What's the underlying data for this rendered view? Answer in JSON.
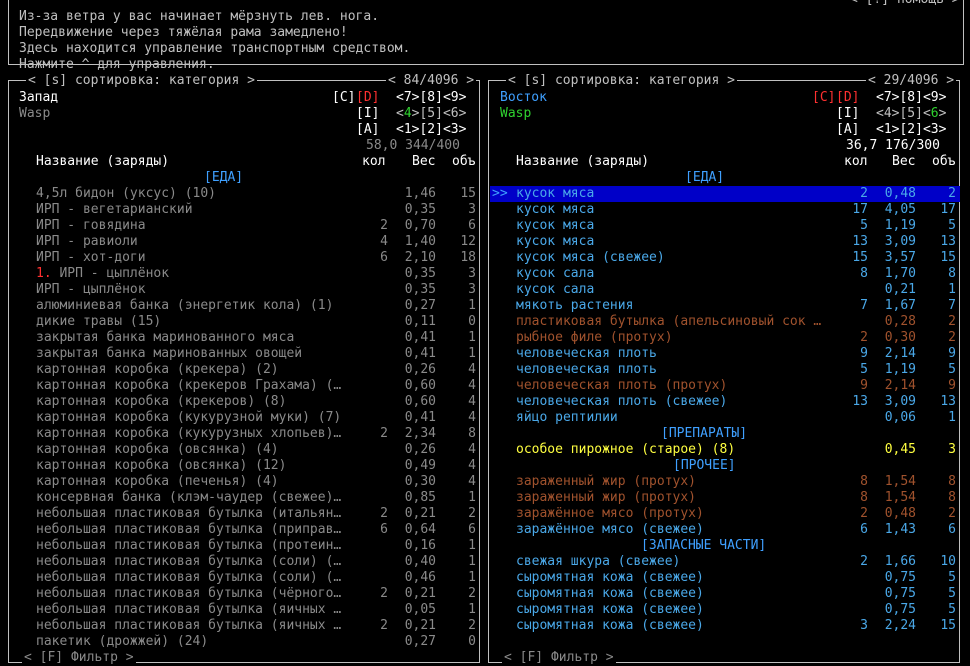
{
  "top": {
    "help": "< [?] помощь >",
    "messages": [
      "Из-за ветра у вас начинает мёрзнуть лев. нога.",
      "Передвижение через тяжёлая рама замедлено!",
      "Здесь находится управление транспортным средством.",
      "Нажмите ^ для управления."
    ]
  },
  "left": {
    "sort": "< [s] сортировка: категория >",
    "count": "< 84/4096 >",
    "location": "Запад",
    "vehicle": "Wasp",
    "tags": [
      "[C]",
      "[D]",
      "[I]",
      "[A]"
    ],
    "grid1": "<7>[8]<9>",
    "grid2": "<4>[5]<6>",
    "grid2_hl": "4",
    "grid3": "<1>[2]<3>",
    "weight_volume": "58,0 344/400",
    "header": {
      "name": "Название (заряды)",
      "qty": "кол",
      "weight": "Вес",
      "vol": "объ"
    },
    "category": "[ЕДА]",
    "items": [
      {
        "n": "4,5л бидон (уксус) (10)",
        "q": "",
        "w": "1,46",
        "v": "15"
      },
      {
        "n": "ИРП - вегетарианский",
        "q": "",
        "w": "0,35",
        "v": "3"
      },
      {
        "n": "ИРП - говядина",
        "q": "2",
        "w": "0,70",
        "v": "6"
      },
      {
        "n": "ИРП - равиоли",
        "q": "4",
        "w": "1,40",
        "v": "12"
      },
      {
        "n": "ИРП - хот-доги",
        "q": "6",
        "w": "2,10",
        "v": "18"
      },
      {
        "n": "ИРП - цыплёнок",
        "q": "",
        "w": "0,35",
        "v": "3",
        "mark": "1. "
      },
      {
        "n": "ИРП - цыплёнок",
        "q": "",
        "w": "0,35",
        "v": "3"
      },
      {
        "n": "алюминиевая банка (энергетик кола) (1)",
        "q": "",
        "w": "0,27",
        "v": "1"
      },
      {
        "n": "дикие травы (15)",
        "q": "",
        "w": "0,11",
        "v": "0"
      },
      {
        "n": "закрытая банка маринованного мяса",
        "q": "",
        "w": "0,41",
        "v": "1"
      },
      {
        "n": "закрытая банка маринованных овощей",
        "q": "",
        "w": "0,41",
        "v": "1"
      },
      {
        "n": "картонная коробка (крекера) (2)",
        "q": "",
        "w": "0,26",
        "v": "4"
      },
      {
        "n": "картонная коробка (крекеров Грахама) (…",
        "q": "",
        "w": "0,60",
        "v": "4"
      },
      {
        "n": "картонная коробка (крекеров) (8)",
        "q": "",
        "w": "0,60",
        "v": "4"
      },
      {
        "n": "картонная коробка (кукурузной муки) (7)",
        "q": "",
        "w": "0,41",
        "v": "4"
      },
      {
        "n": "картонная коробка (кукурузных хлопьев)…",
        "q": "2",
        "w": "2,34",
        "v": "8"
      },
      {
        "n": "картонная коробка (овсянка) (4)",
        "q": "",
        "w": "0,26",
        "v": "4"
      },
      {
        "n": "картонная коробка (овсянка) (12)",
        "q": "",
        "w": "0,49",
        "v": "4"
      },
      {
        "n": "картонная коробка (печенья) (4)",
        "q": "",
        "w": "0,30",
        "v": "4"
      },
      {
        "n": "консервная банка (клэм-чаудер (свежее)…",
        "q": "",
        "w": "0,85",
        "v": "1"
      },
      {
        "n": "небольшая пластиковая бутылка (итальян…",
        "q": "2",
        "w": "0,21",
        "v": "2"
      },
      {
        "n": "небольшая пластиковая бутылка (приправ…",
        "q": "6",
        "w": "0,64",
        "v": "6"
      },
      {
        "n": "небольшая пластиковая бутылка (протеин…",
        "q": "",
        "w": "0,16",
        "v": "1"
      },
      {
        "n": "небольшая пластиковая бутылка (соли) (…",
        "q": "",
        "w": "0,40",
        "v": "1"
      },
      {
        "n": "небольшая пластиковая бутылка (соли) (…",
        "q": "",
        "w": "0,46",
        "v": "1"
      },
      {
        "n": "небольшая пластиковая бутылка (чёрного…",
        "q": "2",
        "w": "0,21",
        "v": "2"
      },
      {
        "n": "небольшая пластиковая бутылка (яичных …",
        "q": "",
        "w": "0,05",
        "v": "1"
      },
      {
        "n": "небольшая пластиковая бутылка (яичных …",
        "q": "2",
        "w": "0,21",
        "v": "2"
      },
      {
        "n": "пакетик (дрожжей) (24)",
        "q": "",
        "w": "0,27",
        "v": "0"
      }
    ],
    "filter": "< [F] Фильтр >"
  },
  "right": {
    "sort": "< [s] сортировка: категория >",
    "count": "< 29/4096 >",
    "location": "Восток",
    "vehicle": "Wasp",
    "tags": [
      "[C]",
      "[D]",
      "[I]",
      "[A]"
    ],
    "grid1": "<7>[8]<9>",
    "grid2": "<4>[5]<6>",
    "grid2_hl": "6",
    "grid3": "<1>[2]<3>",
    "weight_volume": "36,7 176/300",
    "header": {
      "name": "Название (заряды)",
      "qty": "кол",
      "weight": "Вес",
      "vol": "объ"
    },
    "cursor": ">>",
    "sections": [
      {
        "category": "[ЕДА]",
        "items": [
          {
            "n": "кусок мяса",
            "q": "2",
            "w": "0,48",
            "v": "2",
            "c": "blue",
            "sel": true
          },
          {
            "n": "кусок мяса",
            "q": "17",
            "w": "4,05",
            "v": "17",
            "c": "blue"
          },
          {
            "n": "кусок мяса",
            "q": "5",
            "w": "1,19",
            "v": "5",
            "c": "blue"
          },
          {
            "n": "кусок мяса",
            "q": "13",
            "w": "3,09",
            "v": "13",
            "c": "blue"
          },
          {
            "n": "кусок мяса (свежее)",
            "q": "15",
            "w": "3,57",
            "v": "15",
            "c": "blue"
          },
          {
            "n": "кусок сала",
            "q": "8",
            "w": "1,70",
            "v": "8",
            "c": "blue"
          },
          {
            "n": "кусок сала",
            "q": "",
            "w": "0,21",
            "v": "1",
            "c": "blue"
          },
          {
            "n": "мякоть растения",
            "q": "7",
            "w": "1,67",
            "v": "7",
            "c": "blue"
          },
          {
            "n": "пластиковая бутылка (апельсиновый сок …",
            "q": "",
            "w": "0,28",
            "v": "2",
            "c": "brown"
          },
          {
            "n": "рыбное филе (протух)",
            "q": "2",
            "w": "0,30",
            "v": "2",
            "c": "brown"
          },
          {
            "n": "человеческая плоть",
            "q": "9",
            "w": "2,14",
            "v": "9",
            "c": "blue"
          },
          {
            "n": "человеческая плоть",
            "q": "5",
            "w": "1,19",
            "v": "5",
            "c": "blue"
          },
          {
            "n": "человеческая плоть (протух)",
            "q": "9",
            "w": "2,14",
            "v": "9",
            "c": "brown"
          },
          {
            "n": "человеческая плоть (свежее)",
            "q": "13",
            "w": "3,09",
            "v": "13",
            "c": "blue"
          },
          {
            "n": "яйцо рептилии",
            "q": "",
            "w": "0,06",
            "v": "1",
            "c": "blue"
          }
        ]
      },
      {
        "category": "[ПРЕПАРАТЫ]",
        "items": [
          {
            "n": "особое пирожное (старое) (8)",
            "q": "",
            "w": "0,45",
            "v": "3",
            "c": "yellow"
          }
        ]
      },
      {
        "category": "[ПРОЧЕЕ]",
        "items": [
          {
            "n": "зараженный жир (протух)",
            "q": "8",
            "w": "1,54",
            "v": "8",
            "c": "brown"
          },
          {
            "n": "зараженный жир (протух)",
            "q": "8",
            "w": "1,54",
            "v": "8",
            "c": "brown"
          },
          {
            "n": "заражённое мясо (протух)",
            "q": "2",
            "w": "0,48",
            "v": "2",
            "c": "brown"
          },
          {
            "n": "заражённое мясо (свежее)",
            "q": "6",
            "w": "1,43",
            "v": "6",
            "c": "blue"
          }
        ]
      },
      {
        "category": "[ЗАПАСНЫЕ ЧАСТИ]",
        "items": [
          {
            "n": "свежая шкура (свежее)",
            "q": "2",
            "w": "1,66",
            "v": "10",
            "c": "blue"
          },
          {
            "n": "сыромятная кожа (свежее)",
            "q": "",
            "w": "0,75",
            "v": "5",
            "c": "blue"
          },
          {
            "n": "сыромятная кожа (свежее)",
            "q": "",
            "w": "0,75",
            "v": "5",
            "c": "blue"
          },
          {
            "n": "сыромятная кожа (свежее)",
            "q": "",
            "w": "0,75",
            "v": "5",
            "c": "blue"
          },
          {
            "n": "сыромятная кожа (свежее)",
            "q": "3",
            "w": "2,24",
            "v": "15",
            "c": "blue"
          }
        ]
      }
    ],
    "filter": "< [F] Фильтр >"
  },
  "edge": {
    "chars": [
      "ь",
      "",
      "",
      "",
      "",
      "",
      "",
      "",
      "",
      "",
      "",
      ""
    ]
  }
}
